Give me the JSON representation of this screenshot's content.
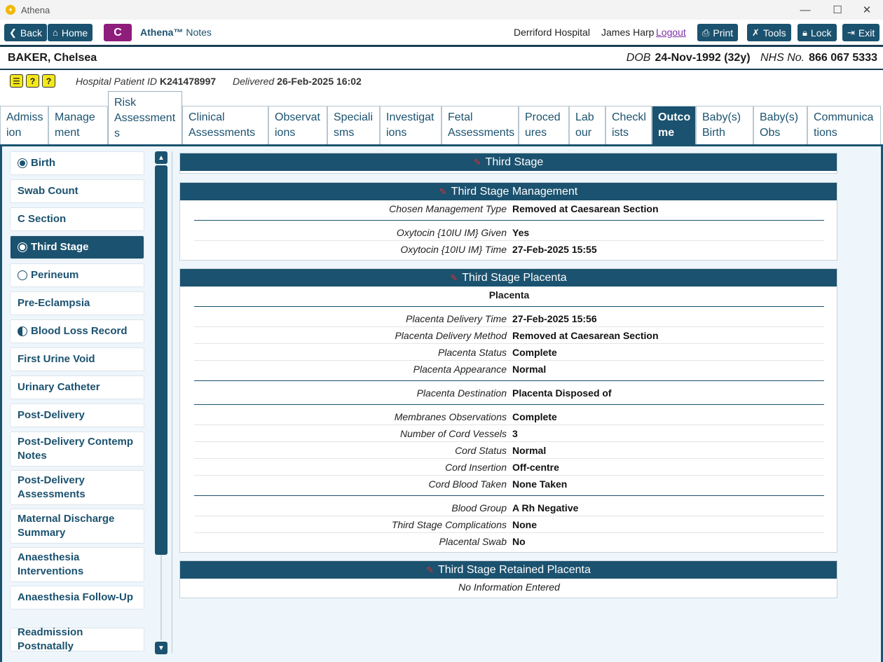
{
  "window": {
    "title": "Athena",
    "minimize": "—",
    "maximize": "☐",
    "close": "✕"
  },
  "toolbar": {
    "back": "Back",
    "home": "Home",
    "c": "C",
    "app_name": "Athena™",
    "app_sub": "Notes",
    "hospital": "Derriford Hospital",
    "user": "James Harp",
    "logout": "Logout",
    "print": "Print",
    "tools": "Tools",
    "lock": "Lock",
    "exit": "Exit"
  },
  "patient": {
    "name": "BAKER, Chelsea",
    "dob_label": "DOB",
    "dob": "24-Nov-1992 (32y)",
    "nhs_label": "NHS No.",
    "nhs": "866 067 5333",
    "hospital_id_label": "Hospital Patient ID",
    "hospital_id": "K241478997",
    "delivered_label": "Delivered",
    "delivered": "26-Feb-2025 16:02"
  },
  "tabs": [
    {
      "l1": "Admiss",
      "l2": "ion"
    },
    {
      "l1": "Manage",
      "l2": "ment"
    },
    {
      "l1": "Risk",
      "l2": "Assessment",
      "l3": "s"
    },
    {
      "l1": "Clinical",
      "l2": "Assessments"
    },
    {
      "l1": "Observat",
      "l2": "ions"
    },
    {
      "l1": "Speciali",
      "l2": "sms"
    },
    {
      "l1": "Investigat",
      "l2": "ions"
    },
    {
      "l1": "Fetal",
      "l2": "Assessments"
    },
    {
      "l1": "Proced",
      "l2": "ures"
    },
    {
      "l1": "Lab",
      "l2": "our"
    },
    {
      "l1": "Checkl",
      "l2": "ists"
    },
    {
      "l1": "Outco",
      "l2": "me"
    },
    {
      "l1": "Baby(s)",
      "l2": "Birth"
    },
    {
      "l1": "Baby(s)",
      "l2": "Obs"
    },
    {
      "l1": "Communica",
      "l2": "tions"
    }
  ],
  "sidebar": [
    {
      "label": "Birth",
      "status": "full"
    },
    {
      "label": "Swab Count",
      "status": ""
    },
    {
      "label": "C Section",
      "status": ""
    },
    {
      "label": "Third Stage",
      "status": "full"
    },
    {
      "label": "Perineum",
      "status": "empty"
    },
    {
      "label": "Pre-Eclampsia",
      "status": ""
    },
    {
      "label": "Blood Loss Record",
      "status": "half"
    },
    {
      "label": "First Urine Void",
      "status": ""
    },
    {
      "label": "Urinary Catheter",
      "status": ""
    },
    {
      "label": "Post-Delivery",
      "status": ""
    },
    {
      "label": "Post-Delivery Contemp Notes",
      "status": ""
    },
    {
      "label": "Post-Delivery Assessments",
      "status": ""
    },
    {
      "label": "Maternal Discharge Summary",
      "status": ""
    },
    {
      "label": "Anaesthesia Interventions",
      "status": ""
    },
    {
      "label": "Anaesthesia Follow-Up",
      "status": ""
    },
    {
      "label": "Readmission Postnatally",
      "status": ""
    }
  ],
  "panels": {
    "third_stage": {
      "title": "Third Stage"
    },
    "management": {
      "title": "Third Stage Management",
      "rows": [
        {
          "label": "Chosen Management Type",
          "value": "Removed at Caesarean Section"
        },
        {
          "label": "Oxytocin {10IU IM} Given",
          "value": "Yes"
        },
        {
          "label": "Oxytocin {10IU IM} Time",
          "value": "27-Feb-2025 15:55"
        }
      ]
    },
    "placenta": {
      "title": "Third Stage Placenta",
      "subtitle": "Placenta",
      "rows": [
        {
          "label": "Placenta Delivery Time",
          "value": "27-Feb-2025 15:56"
        },
        {
          "label": "Placenta Delivery Method",
          "value": "Removed at Caesarean Section"
        },
        {
          "label": "Placenta Status",
          "value": "Complete"
        },
        {
          "label": "Placenta Appearance",
          "value": "Normal"
        },
        {
          "label": "Placenta Destination",
          "value": "Placenta Disposed of"
        },
        {
          "label": "Membranes Observations",
          "value": "Complete"
        },
        {
          "label": "Number of Cord Vessels",
          "value": "3"
        },
        {
          "label": "Cord Status",
          "value": "Normal"
        },
        {
          "label": "Cord Insertion",
          "value": "Off-centre"
        },
        {
          "label": "Cord Blood Taken",
          "value": "None Taken"
        },
        {
          "label": "Blood Group",
          "value": "A Rh Negative"
        },
        {
          "label": "Third Stage Complications",
          "value": "None"
        },
        {
          "label": "Placental Swab",
          "value": "No"
        }
      ]
    },
    "retained": {
      "title": "Third Stage Retained Placenta",
      "empty": "No Information Entered"
    }
  },
  "colors": {
    "primary": "#1b526f",
    "c_button": "#8e1d7c",
    "logout": "#7b2fa6",
    "background": "#eef6fb"
  }
}
